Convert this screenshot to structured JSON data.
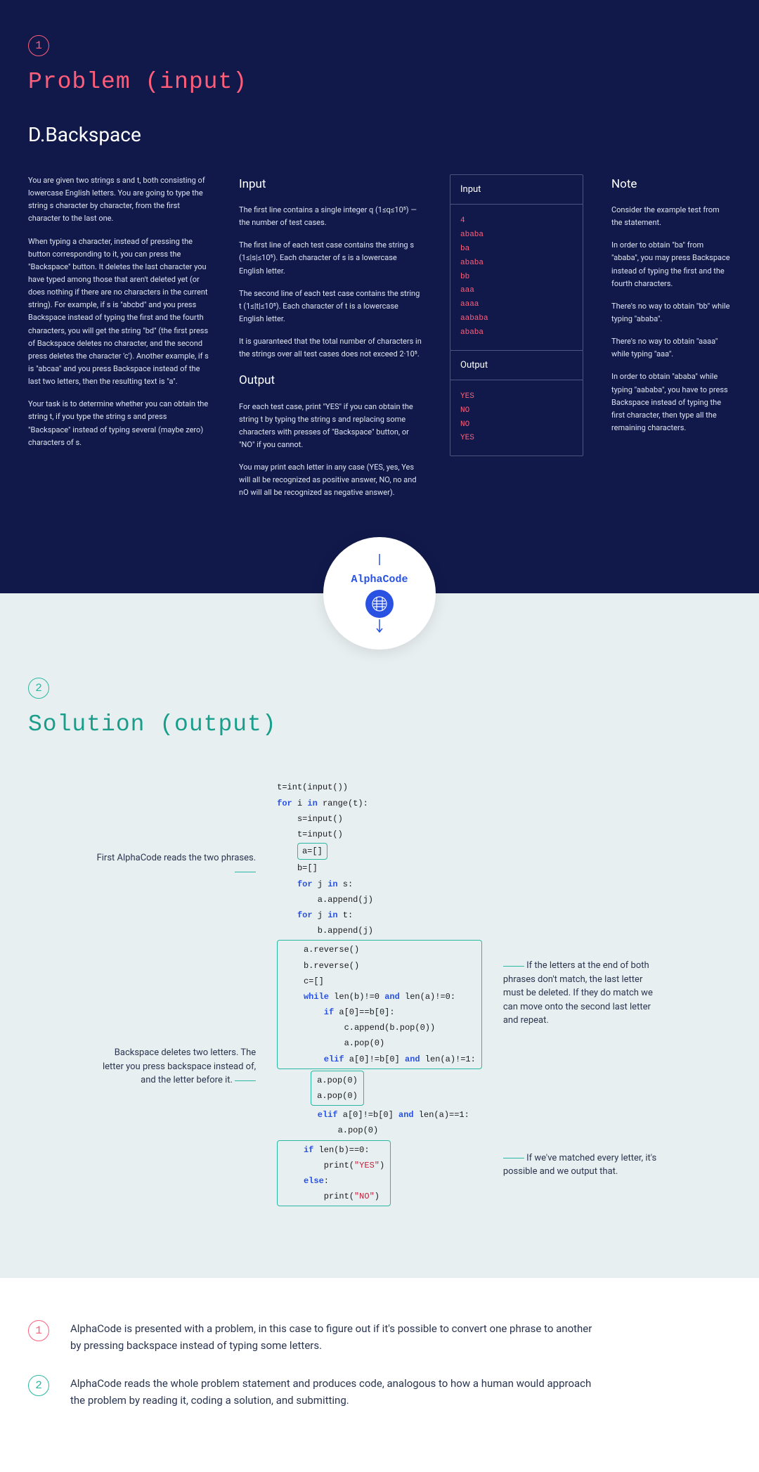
{
  "problem": {
    "badge": "1",
    "heading": "Problem (input)",
    "title": "D.Backspace",
    "description": [
      "You are given two strings s and t, both consisting of lowercase English letters. You are going to type the string s character by character, from the first character to the last one.",
      "When typing a character, instead of pressing the button corresponding to it, you can press the \"Backspace\" button. It deletes the last character you have typed among those that aren't deleted yet (or does nothing if there are no characters in the current string). For example, if s is \"abcbd\" and you press Backspace instead of typing the first and the fourth characters, you will get the string \"bd\" (the first press of Backspace deletes no character, and the second press deletes the character 'c'). Another example, if s is \"abcaa\" and you press Backspace instead of the last two letters, then the resulting text is \"a\".",
      "Your task is to determine whether you can obtain the string t, if you type the string s and press \"Backspace\" instead of typing several (maybe zero) characters of s."
    ],
    "input_heading": "Input",
    "input_paragraphs": [
      "The first line contains a single integer q (1≤q≤10⁵) — the number of test cases.",
      "The first line of each test case contains the string s (1≤|s|≤10⁵). Each character of s is a lowercase English letter.",
      "The second line of each test case contains the string t (1≤|t|≤10⁵). Each character of t is a lowercase English letter.",
      "It is guaranteed that the total number of characters in the strings over all test cases does not exceed 2·10⁵."
    ],
    "output_heading": "Output",
    "output_paragraphs": [
      "For each test case, print \"YES\" if you can obtain the string t by typing the string s and replacing some characters with presses of \"Backspace\" button, or \"NO\" if you cannot.",
      "You may print each letter in any case (YES, yes, Yes will all be recognized as positive answer, NO, no and nO will all be recognized as negative answer)."
    ],
    "io_input_label": "Input",
    "io_input": "4\nababa\nba\nababa\nbb\naaa\naaaa\naababa\nababa",
    "io_output_label": "Output",
    "io_output": "YES\nNO\nNO\nYES",
    "note_heading": "Note",
    "note_paragraphs": [
      "Consider the example test from the statement.",
      "In order to obtain \"ba\" from \"ababa\", you may press Backspace instead of typing the first and the fourth characters.",
      "There's no way to obtain \"bb\" while typing \"ababa\".",
      "There's no way to obtain \"aaaa\" while typing \"aaa\".",
      "In order to obtain \"ababa\" while typing \"aababa\", you have to press Backspace instead of typing the first character, then type all the remaining characters."
    ]
  },
  "alphacode_label": "AlphaCode",
  "solution": {
    "badge": "2",
    "heading": "Solution (output)",
    "annotations_left": [
      "First AlphaCode reads the two phrases.",
      "Backspace deletes two letters. The letter you press backspace instead of, and the letter before it."
    ],
    "annotations_right": [
      "If the letters at the end of both phrases don't match, the last letter must be deleted. If they do match we can move onto the second last letter and repeat.",
      "If we've matched every letter, it's possible and we output that."
    ],
    "code": {
      "l1": "t=int(input())",
      "l2": "for i in range(t):",
      "l3": "    s=input()",
      "l4": "    t=input()",
      "l5a": "    ",
      "l5b": "a=[]",
      "l6": "    b=[]",
      "l7": "    for j in s:",
      "l8": "        a.append(j)",
      "l9": "    for j in t:",
      "l10": "        b.append(j)",
      "l11": "    a.reverse()",
      "l12": "    b.reverse()",
      "l13": "    c=[]",
      "l14": "    while len(b)!=0 and len(a)!=0:",
      "l15": "        if a[0]==b[0]:",
      "l16": "            c.append(b.pop(0))",
      "l17": "            a.pop(0)",
      "l18": "        elif a[0]!=b[0] and len(a)!=1:",
      "l19": "            a.pop(0)",
      "l20": "            a.pop(0)",
      "l21": "        elif a[0]!=b[0] and len(a)==1:",
      "l22": "            a.pop(0)",
      "l23": "    if len(b)==0:",
      "l24": "        print(\"YES\")",
      "l25": "    else:",
      "l26": "        print(\"NO\")"
    }
  },
  "footer": [
    {
      "num": "1",
      "text": "AlphaCode is presented with a problem, in this case to figure out if it's possible to convert one phrase to another by pressing backspace instead of typing some letters."
    },
    {
      "num": "2",
      "text": "AlphaCode reads the whole problem statement and produces code, analogous to how a human would approach the problem by reading it, coding a solution, and submitting."
    }
  ]
}
